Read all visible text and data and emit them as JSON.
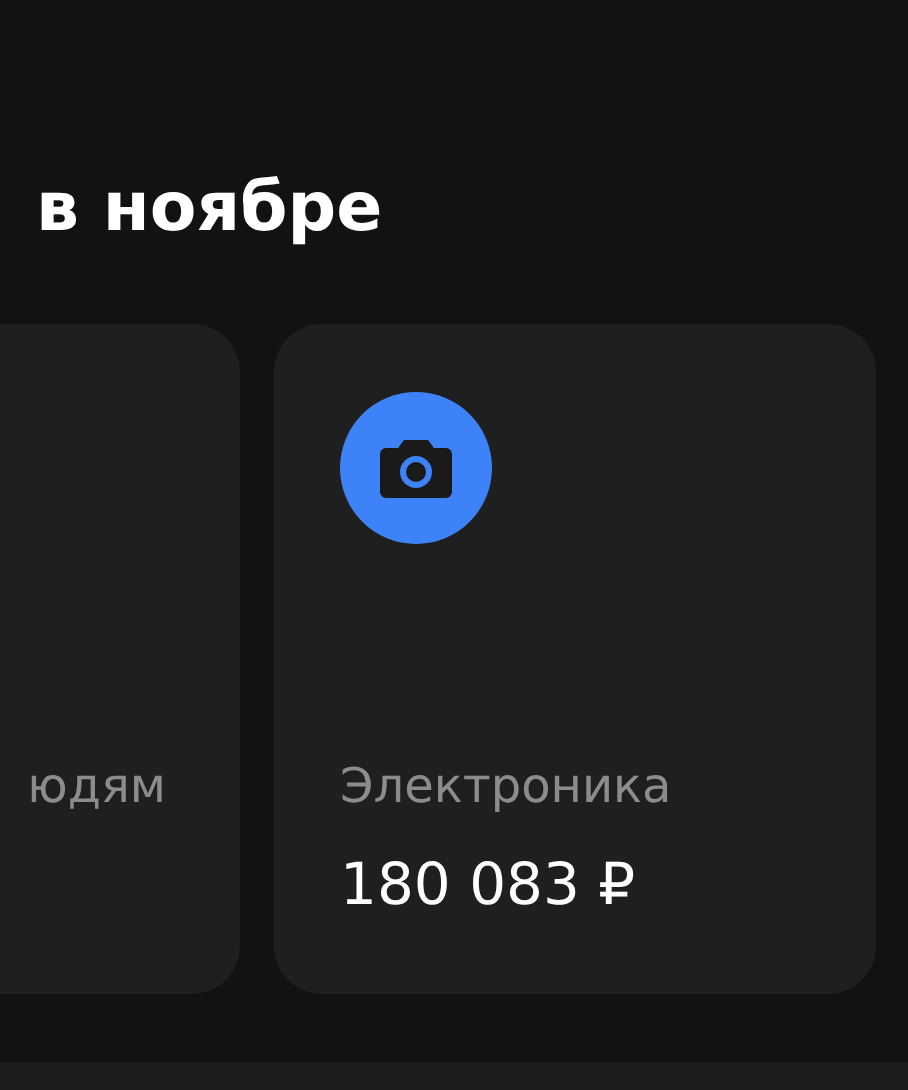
{
  "title": "в ноябре",
  "categories": [
    {
      "label": "юдям"
    },
    {
      "label": "Электроника",
      "amount": "180 083 ₽",
      "kind": "camera"
    }
  ]
}
